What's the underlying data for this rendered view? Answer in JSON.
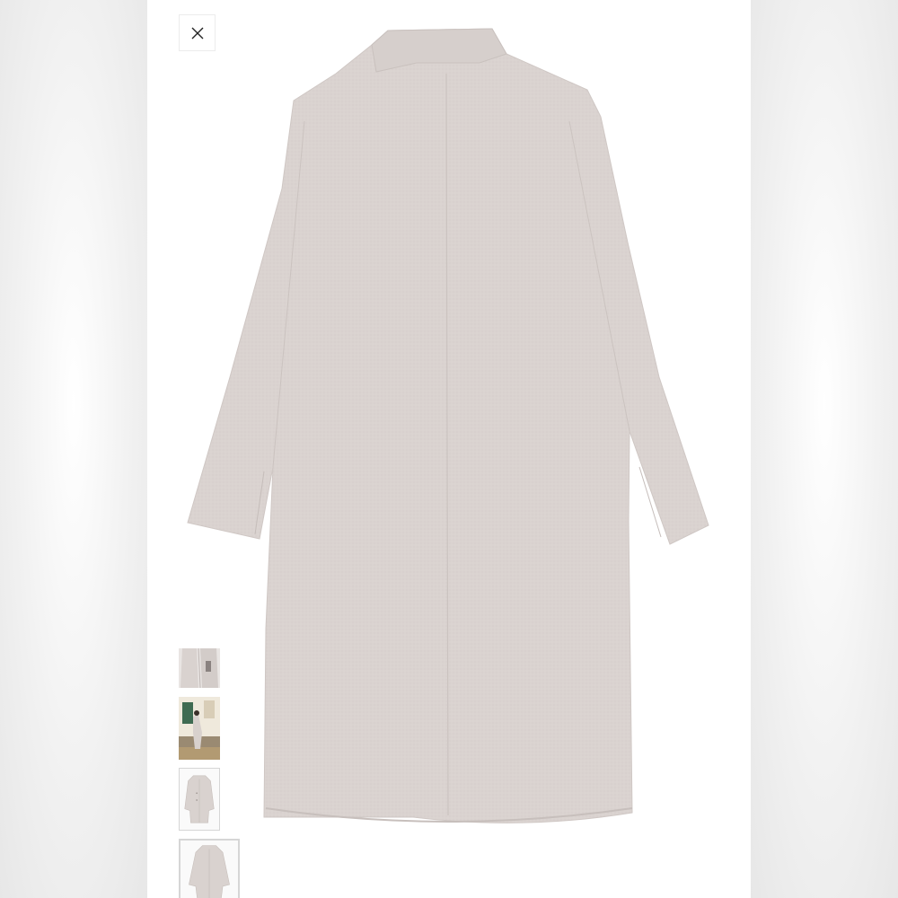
{
  "viewer": {
    "close_icon": "close-icon",
    "main_image_icon": "coat-back-view",
    "selected_thumbnail": 4,
    "colors": {
      "coat": "#d9d2cf",
      "coat_shadow": "#c8c0bd",
      "background": "#ffffff",
      "side_panels": "#ececec"
    }
  },
  "thumbnails": [
    {
      "icon": "coat-detail-thumbnail"
    },
    {
      "icon": "street-photo-thumbnail"
    },
    {
      "icon": "coat-front-thumbnail"
    },
    {
      "icon": "coat-back-thumbnail"
    }
  ]
}
